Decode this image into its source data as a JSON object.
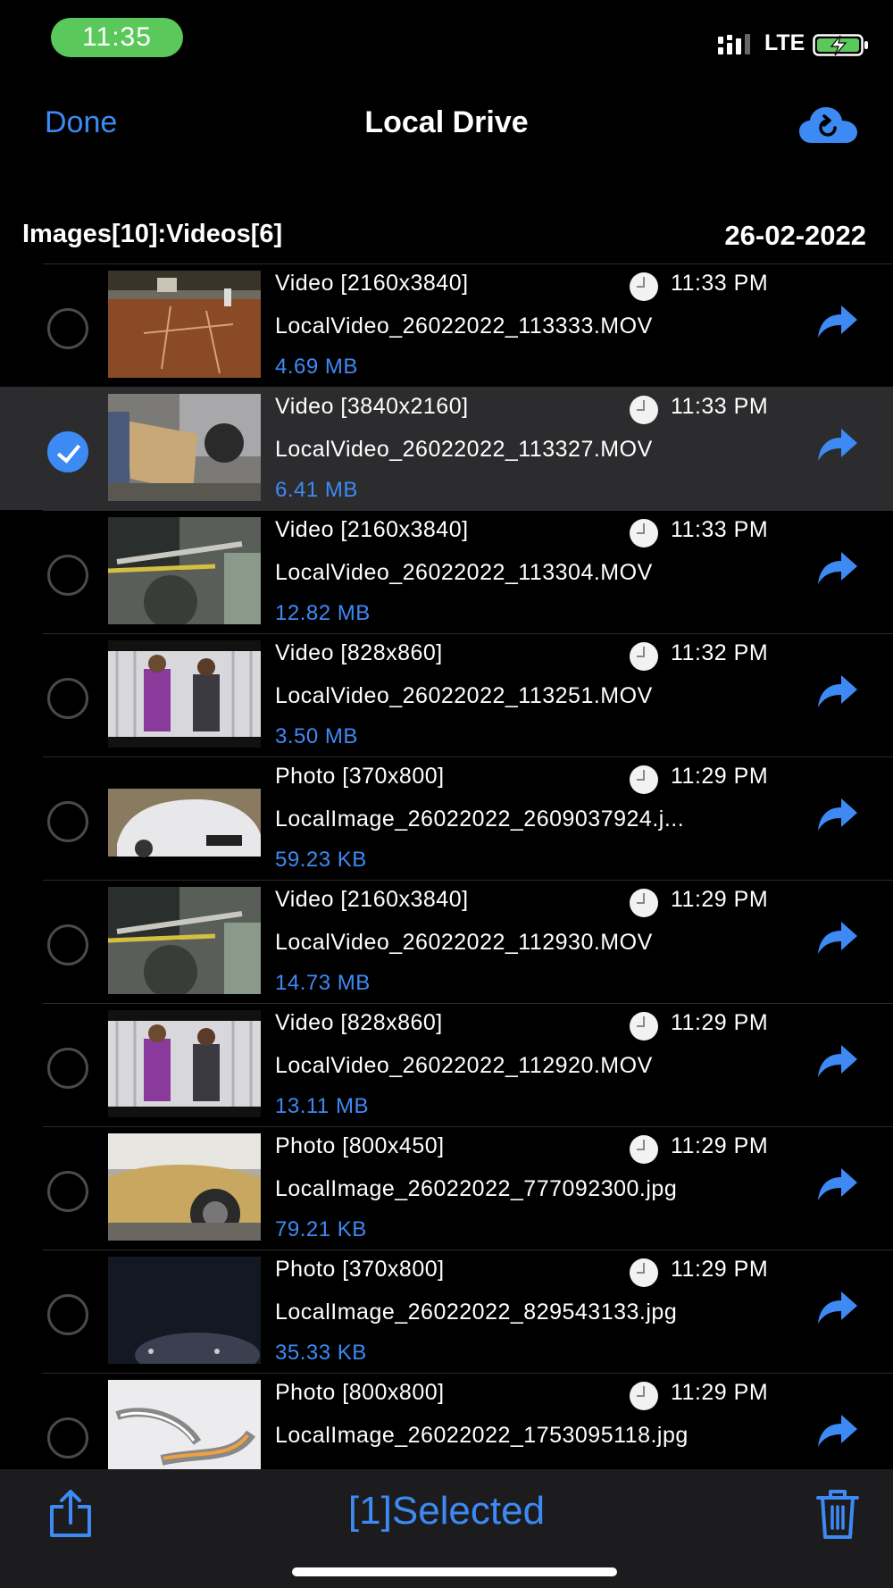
{
  "status_bar": {
    "time": "11:35",
    "network": "LTE"
  },
  "nav": {
    "done_label": "Done",
    "title": "Local Drive"
  },
  "summary": {
    "counts": "Images[10]:Videos[6]",
    "date": "26-02-2022"
  },
  "colors": {
    "accent": "#3d8af5",
    "time_pill": "#5ac85a",
    "selected_row": "#2c2c2e"
  },
  "files": [
    {
      "type": "Video [2160x3840]",
      "time": "11:33 PM",
      "name": "LocalVideo_26022022_113333.MOV",
      "size": "4.69 MB",
      "selected": false
    },
    {
      "type": "Video [3840x2160]",
      "time": "11:33 PM",
      "name": "LocalVideo_26022022_113327.MOV",
      "size": "6.41 MB",
      "selected": true
    },
    {
      "type": "Video [2160x3840]",
      "time": "11:33 PM",
      "name": "LocalVideo_26022022_113304.MOV",
      "size": "12.82 MB",
      "selected": false
    },
    {
      "type": "Video [828x860]",
      "time": "11:32 PM",
      "name": "LocalVideo_26022022_113251.MOV",
      "size": "3.50 MB",
      "selected": false
    },
    {
      "type": "Photo [370x800]",
      "time": "11:29 PM",
      "name": "LocalImage_26022022_2609037924.j...",
      "size": "59.23 KB",
      "selected": false
    },
    {
      "type": "Video [2160x3840]",
      "time": "11:29 PM",
      "name": "LocalVideo_26022022_112930.MOV",
      "size": "14.73 MB",
      "selected": false
    },
    {
      "type": "Video [828x860]",
      "time": "11:29 PM",
      "name": "LocalVideo_26022022_112920.MOV",
      "size": "13.11 MB",
      "selected": false
    },
    {
      "type": "Photo [800x450]",
      "time": "11:29 PM",
      "name": "LocalImage_26022022_777092300.jpg",
      "size": "79.21 KB",
      "selected": false
    },
    {
      "type": "Photo [370x800]",
      "time": "11:29 PM",
      "name": "LocalImage_26022022_829543133.jpg",
      "size": "35.33 KB",
      "selected": false
    },
    {
      "type": "Photo [800x800]",
      "time": "11:29 PM",
      "name": "LocalImage_26022022_1753095118.jpg",
      "size": "",
      "selected": false
    }
  ],
  "toolbar": {
    "selected_label": "[1]Selected"
  }
}
